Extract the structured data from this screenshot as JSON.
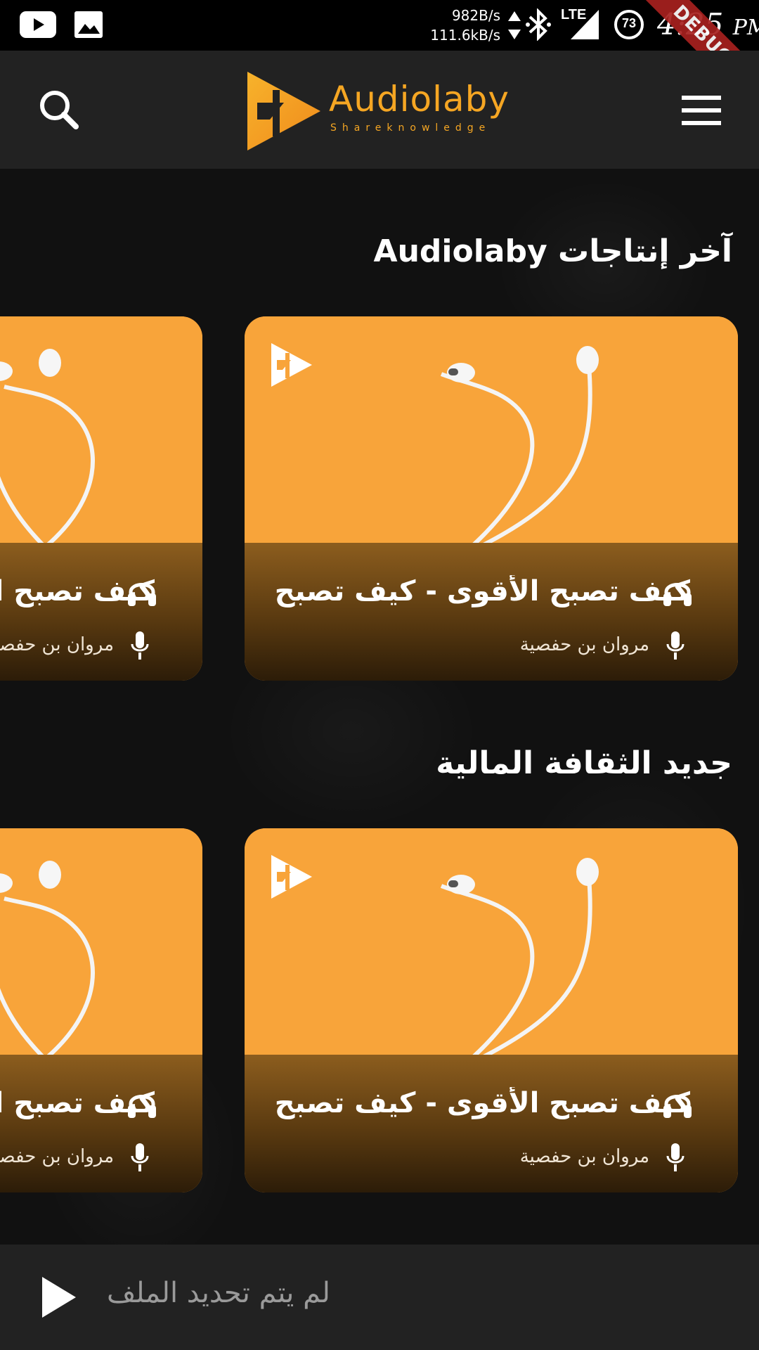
{
  "status_bar": {
    "net_down": "982B/s",
    "net_up": "111.6kB/s",
    "network_type": "LTE",
    "battery_percent": "73",
    "time": "4:25",
    "ampm": "PM",
    "debug_label": "DEBUG",
    "icons": [
      "youtube-icon",
      "gallery-icon",
      "data-arrows-icon",
      "bluetooth-icon",
      "signal-icon",
      "battery-icon"
    ]
  },
  "header": {
    "app_name": "Audiolaby",
    "tagline": "Shareknowledge",
    "accent_color": "#f5a623"
  },
  "sections": [
    {
      "title": "آخر إنتاجات Audiolaby",
      "cards": [
        {
          "title": "كيف تصبح الأقوى - كيف تصبح",
          "author": "مروان بن حفصية"
        },
        {
          "title": "كيف تصبح الأقوى - كيف تصبح",
          "author": "مروان بن حفصية"
        }
      ]
    },
    {
      "title": "جديد الثقافة المالية",
      "cards": [
        {
          "title": "كيف تصبح الأقوى - كيف تصبح",
          "author": "مروان بن حفصية"
        },
        {
          "title": "كيف تصبح الأقوى - كيف تصبح",
          "author": "مروان بن حفصية"
        }
      ]
    }
  ],
  "player": {
    "status": "لم يتم تحديد الملف"
  }
}
